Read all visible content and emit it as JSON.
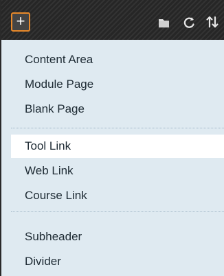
{
  "toolbar": {
    "add_label": "+",
    "icons": [
      "add-icon",
      "folder-icon",
      "refresh-icon",
      "sort-icon"
    ]
  },
  "menu": {
    "items": [
      {
        "label": "Content Area"
      },
      {
        "label": "Module Page"
      },
      {
        "label": "Blank Page"
      },
      {
        "label": "Tool Link"
      },
      {
        "label": "Web Link"
      },
      {
        "label": "Course Link"
      },
      {
        "label": "Subheader"
      },
      {
        "label": "Divider"
      }
    ],
    "selected_label": "Tool Link"
  },
  "colors": {
    "menu_bg": "#dfeaf1",
    "toolbar_bg": "#2b2b2b",
    "accent_border": "#e8892a",
    "text": "#1d2a33"
  }
}
